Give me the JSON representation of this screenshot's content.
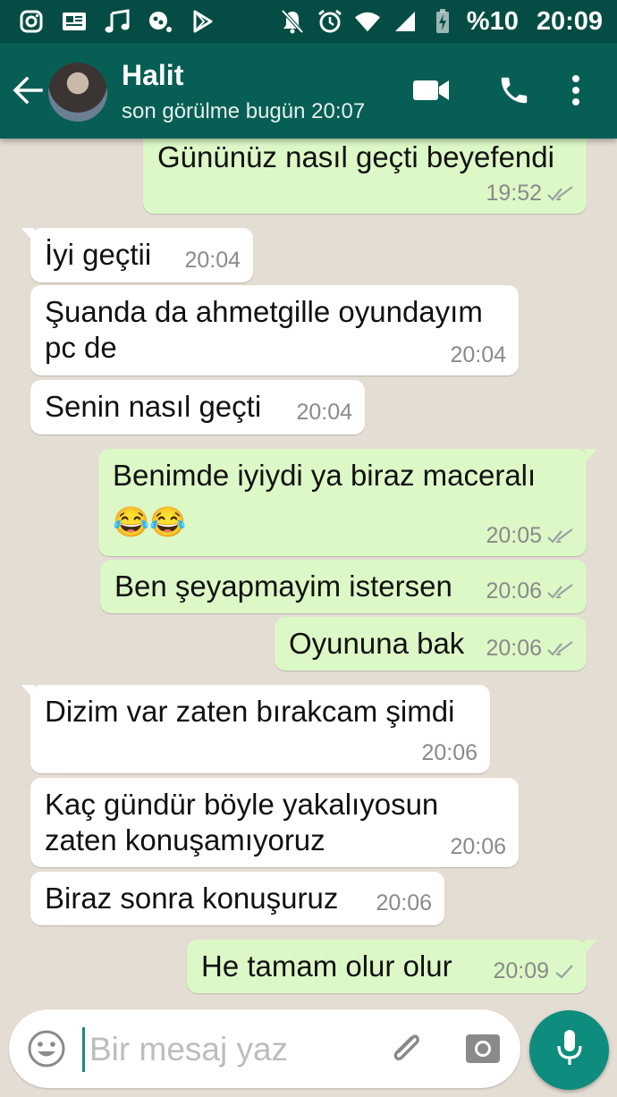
{
  "status_bar": {
    "battery": "%10",
    "time": "20:09",
    "icons": [
      "instagram-icon",
      "news-icon",
      "music-icon",
      "game-icon",
      "play-store-icon",
      "mute-icon",
      "alarm-icon",
      "wifi-icon",
      "signal-icon",
      "battery-charging-icon"
    ]
  },
  "header": {
    "contact_name": "Halit",
    "last_seen": "son görülme bugün 20:07",
    "icons": [
      "back-arrow-icon",
      "video-call-icon",
      "phone-icon",
      "more-vert-icon"
    ]
  },
  "messages": [
    {
      "dir": "out",
      "text": "Gününüz nasıl geçti beyefendi",
      "time": "19:52",
      "tick": "read"
    },
    {
      "dir": "in",
      "text": "İyi geçtii",
      "time": "20:04"
    },
    {
      "dir": "in",
      "text": "Şuanda da ahmetgille oyundayım\npc de",
      "time": "20:04"
    },
    {
      "dir": "in",
      "text": "Senin nasıl geçti",
      "time": "20:04"
    },
    {
      "dir": "out",
      "text": "Benimde iyiydi ya biraz maceralı\n😂😂",
      "time": "20:05",
      "tick": "read"
    },
    {
      "dir": "out",
      "text": "Ben şeyapmayim istersen",
      "time": "20:06",
      "tick": "read"
    },
    {
      "dir": "out",
      "text": "Oyununa bak",
      "time": "20:06",
      "tick": "read"
    },
    {
      "dir": "in",
      "text": "Dizim var zaten bırakcam şimdi",
      "time": "20:06"
    },
    {
      "dir": "in",
      "text": "Kaç gündür böyle yakalıyosun\nzaten konuşamıyoruz",
      "time": "20:06"
    },
    {
      "dir": "in",
      "text": "Biraz sonra konuşuruz",
      "time": "20:06"
    },
    {
      "dir": "out",
      "text": "He tamam olur olur",
      "time": "20:09",
      "tick": "sent"
    }
  ],
  "composer": {
    "placeholder": "Bir mesaj yaz",
    "value": "",
    "icons": [
      "emoji-icon",
      "attach-icon",
      "camera-icon",
      "mic-icon"
    ]
  },
  "colors": {
    "status_bar": "#054d44",
    "app_bar": "#075e54",
    "chat_bg": "#e4ddd4",
    "outgoing_bubble": "#dcf8c6",
    "incoming_bubble": "#ffffff",
    "accent": "#0e8d7e"
  }
}
